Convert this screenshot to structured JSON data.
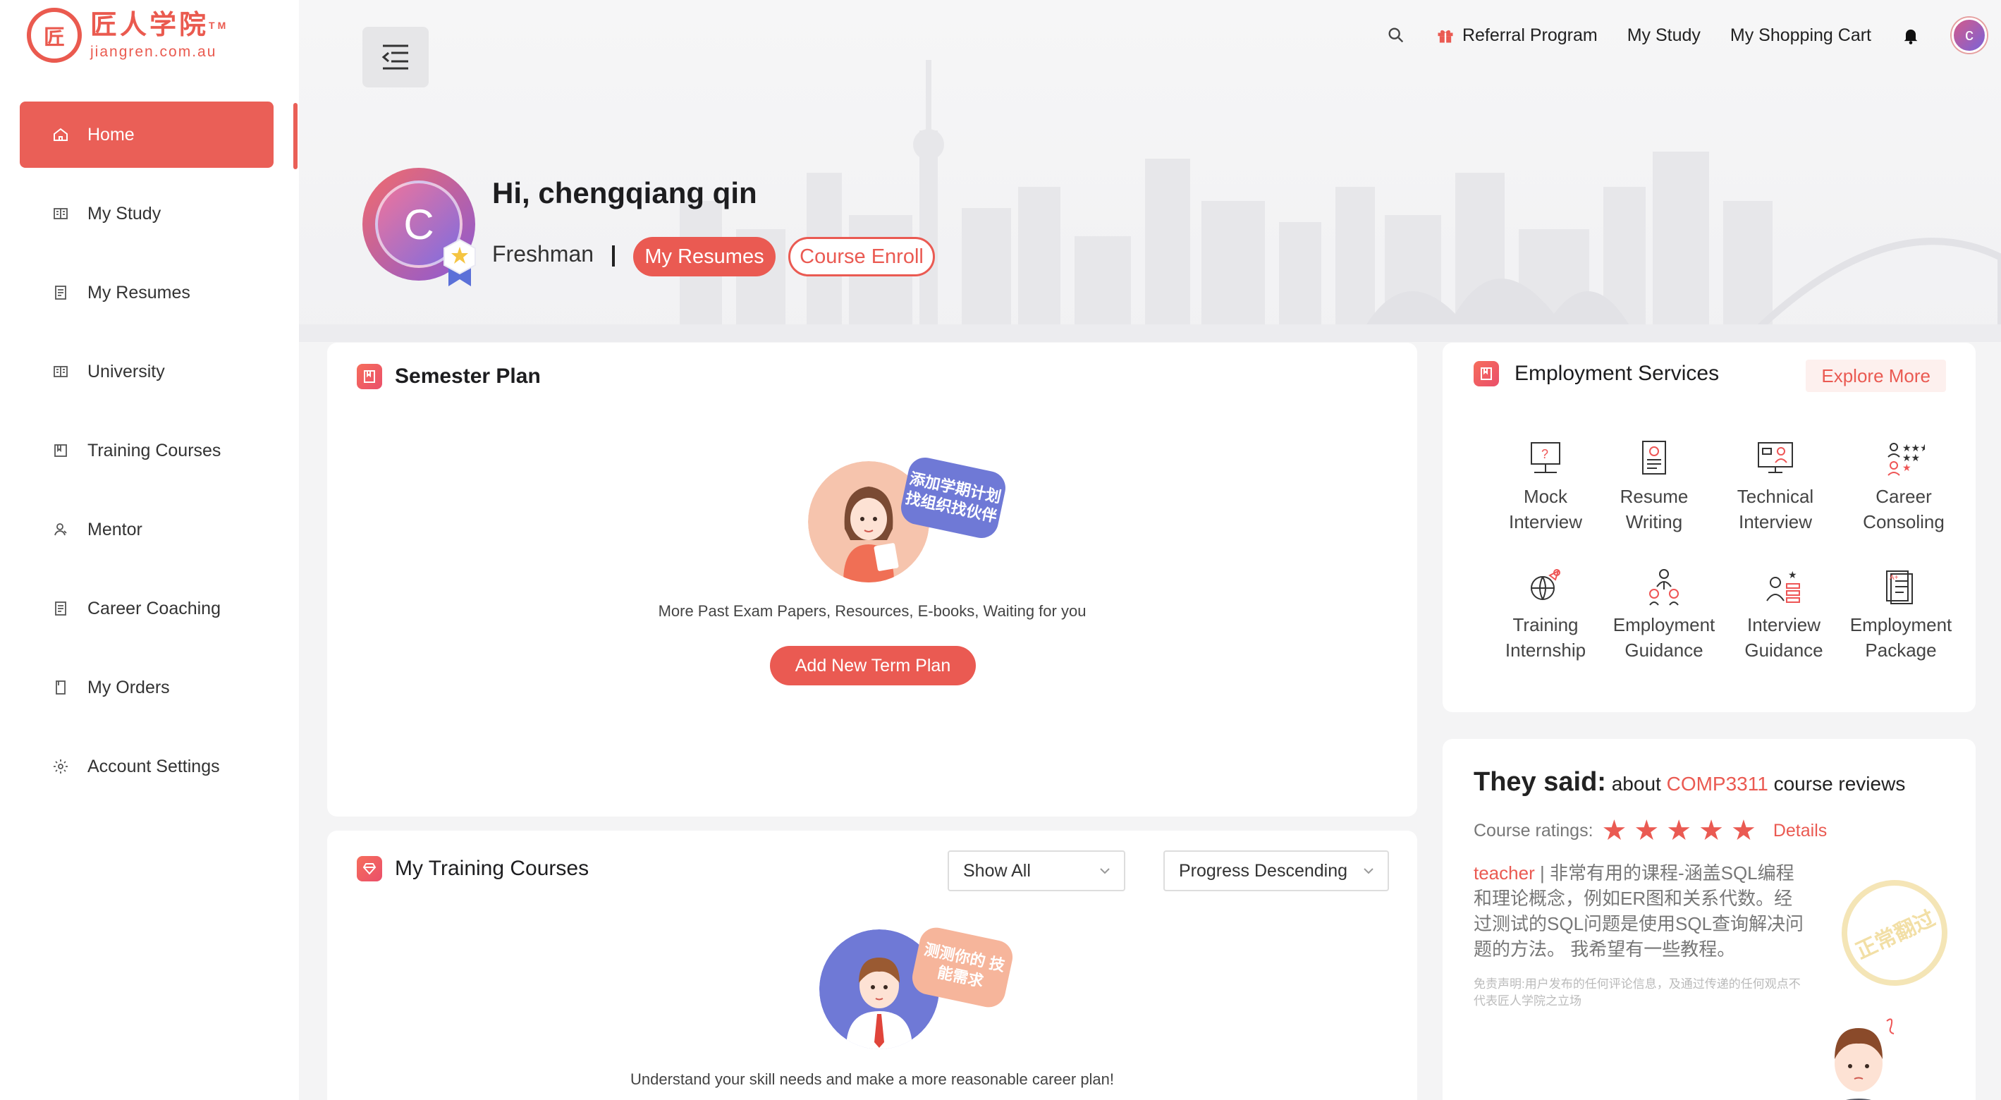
{
  "brand": {
    "logo_cn": "匠人学院",
    "logo_tm": "TM",
    "logo_url": "jiangren.com.au",
    "logo_mark": "匠",
    "accent_color": "#ea5a52"
  },
  "sidebar": {
    "items": [
      {
        "label": "Home",
        "icon": "home-icon",
        "active": true
      },
      {
        "label": "My Study",
        "icon": "book-icon"
      },
      {
        "label": "My Resumes",
        "icon": "resume-icon"
      },
      {
        "label": "University",
        "icon": "university-icon"
      },
      {
        "label": "Training Courses",
        "icon": "training-icon"
      },
      {
        "label": "Mentor",
        "icon": "mentor-icon"
      },
      {
        "label": "Career Coaching",
        "icon": "coaching-icon"
      },
      {
        "label": "My Orders",
        "icon": "orders-icon"
      },
      {
        "label": "Account Settings",
        "icon": "gear-icon"
      }
    ]
  },
  "topbar": {
    "referral": "Referral Program",
    "my_study": "My Study",
    "cart": "My Shopping Cart",
    "avatar_letter": "c"
  },
  "profile": {
    "greeting": "Hi, chengqiang qin",
    "avatar_letter": "C",
    "level": "Freshman",
    "resumes_btn": "My Resumes",
    "enroll_btn": "Course Enroll"
  },
  "semester": {
    "title": "Semester Plan",
    "bubble": "添加学期计划 找组织找伙伴",
    "message": "More Past Exam Papers, Resources, E-books, Waiting for you",
    "add_btn": "Add New Term Plan"
  },
  "training": {
    "title": "My Training Courses",
    "filter_value": "Show All",
    "sort_value": "Progress Descending",
    "bubble": "测测你的 技能需求",
    "message": "Understand your skill needs and make a more reasonable career plan!"
  },
  "employment": {
    "title": "Employment Services",
    "explore": "Explore More",
    "services": [
      {
        "line1": "Mock",
        "line2": "Interview",
        "icon": "mock-interview-icon"
      },
      {
        "line1": "Resume",
        "line2": "Writing",
        "icon": "resume-writing-icon"
      },
      {
        "line1": "Technical",
        "line2": "Interview",
        "icon": "technical-interview-icon"
      },
      {
        "line1": "Career",
        "line2": "Consoling",
        "icon": "career-consoling-icon"
      },
      {
        "line1": "Training",
        "line2": "Internship",
        "icon": "training-internship-icon"
      },
      {
        "line1": "Employment",
        "line2": "Guidance",
        "icon": "employment-guidance-icon"
      },
      {
        "line1": "Interview",
        "line2": "Guidance",
        "icon": "interview-guidance-icon"
      },
      {
        "line1": "Employment",
        "line2": "Package",
        "icon": "employment-package-icon"
      }
    ]
  },
  "reviews": {
    "title_bold": "They said:",
    "title_pre": "about",
    "course": "COMP3311",
    "title_post": "course reviews",
    "ratings_label": "Course ratings:",
    "rating": 5,
    "details": "Details",
    "reviewer": "teacher",
    "text": "| 非常有用的课程-涵盖SQL编程和理论概念，例如ER图和关系代数。经过测试的SQL问题是使用SQL查询解决问题的方法。 我希望有一些教程。",
    "disclaimer": "免责声明:用户发布的任何评论信息，及通过传递的任何观点不代表匠人学院之立场",
    "stamp": "正常翻过"
  }
}
